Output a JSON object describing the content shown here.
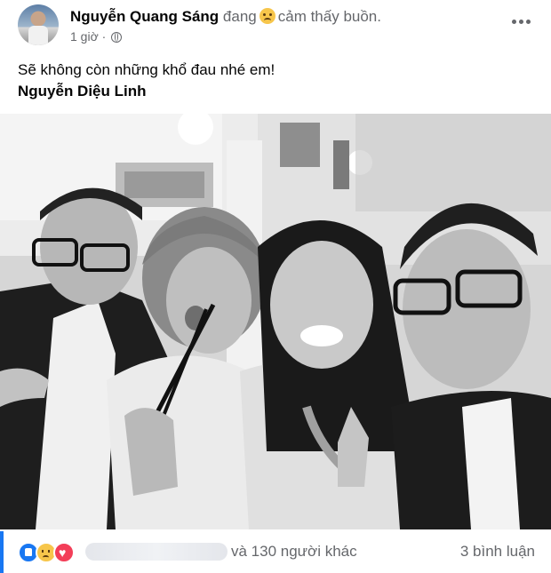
{
  "post": {
    "author": "Nguyễn Quang Sáng",
    "feeling_prefix": "đang",
    "feeling_icon": "sad-face-icon",
    "feeling_text": "cảm thấy buồn.",
    "time": "1 giờ",
    "privacy_separator": "·",
    "privacy_icon": "globe-icon",
    "text": "Sẽ không còn những khổ đau nhé em!",
    "tagged": "Nguyễn Diệu Linh"
  },
  "photo": {
    "style": "black-and-white",
    "description_icon": "group-selfie-photo"
  },
  "footer": {
    "reaction_icons": [
      "like-icon",
      "sad-icon",
      "love-icon"
    ],
    "others_text": "và 130 người khác",
    "comments_text": "3 bình luận"
  },
  "colors": {
    "accent": "#1877f2",
    "text_primary": "#050505",
    "text_secondary": "#65676b"
  }
}
